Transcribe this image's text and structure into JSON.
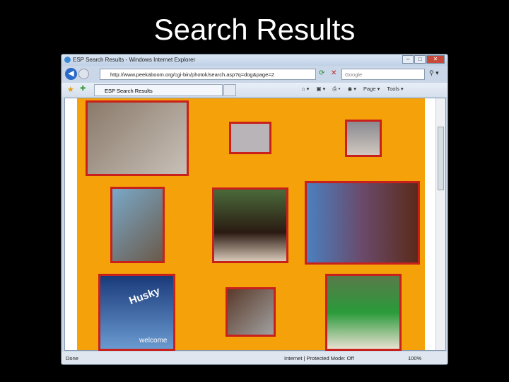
{
  "slide": {
    "title": "Search Results"
  },
  "browser": {
    "window_title": "ESP Search Results - Windows Internet Explorer",
    "address": "http://www.peekaboom.org/cgi-bin/photok/search.asp?q=dog&page=2",
    "search_placeholder": "Google",
    "tab_label": "ESP Search Results",
    "tools": {
      "page": "Page ▾",
      "tools": "Tools ▾"
    },
    "status": {
      "text": "Done",
      "zone": "Internet | Protected Mode: Off",
      "zoom": "100%"
    }
  },
  "results": {
    "images": [
      "dog photo 1",
      "dog photo 2",
      "dog photo 3",
      "dog photo 4",
      "dog photo 5",
      "dog photo 6",
      "dog photo 7",
      "dog photo 8",
      "dog photo 9"
    ],
    "welcome_text": "welcome",
    "husky_text": "Husky"
  },
  "colors": {
    "page_bg": "#f5a20a",
    "border": "#c8201a"
  }
}
